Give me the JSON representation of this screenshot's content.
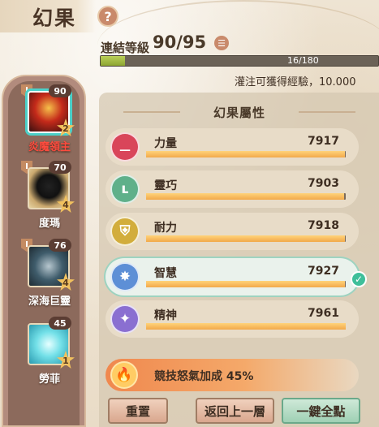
{
  "header": {
    "title": "幻果",
    "help_icon": "question-icon"
  },
  "link_level": {
    "label": "連結等級",
    "value": "90/95",
    "list_icon": "list-icon"
  },
  "experience": {
    "text": "16/180",
    "progress_fraction": 0.089,
    "fill_color": "#9db73f"
  },
  "infuse_text": "灌注可獲得經驗，10.000",
  "characters": [
    {
      "name": "炎魔領主",
      "level": "90",
      "stars": "2",
      "selected": true
    },
    {
      "name": "度瑪",
      "level": "70",
      "stars": "4",
      "selected": false
    },
    {
      "name": "深海巨靈",
      "level": "76",
      "stars": "4",
      "selected": false
    },
    {
      "name": "勞菲",
      "level": "45",
      "stars": "1",
      "selected": false
    }
  ],
  "attributes_panel": {
    "title": "幻果屬性",
    "items": [
      {
        "label": "力量",
        "value": "7917",
        "icon": "dumbbell-icon",
        "icon_color": "#d9455a",
        "progress_fraction": 0.995
      },
      {
        "label": "靈巧",
        "value": "7903",
        "icon": "boot-icon",
        "icon_color": "#5fb08a",
        "progress_fraction": 0.993
      },
      {
        "label": "耐力",
        "value": "7918",
        "icon": "shield-icon",
        "icon_color": "#d2ad3c",
        "progress_fraction": 0.995
      },
      {
        "label": "智慧",
        "value": "7927",
        "icon": "gear-icon",
        "icon_color": "#5d8fd6",
        "progress_fraction": 0.996
      },
      {
        "label": "精神",
        "value": "7961",
        "icon": "spirit-icon",
        "icon_color": "#8a6fd1",
        "progress_fraction": 1.0
      }
    ],
    "bonus": {
      "label": "競技怒氣加成 45%",
      "icon": "flame-icon"
    }
  },
  "buttons": {
    "reset": "重置",
    "back": "返回上一層",
    "all_points": "一鍵全點"
  },
  "colors": {
    "accent_bar": "#f2a94a",
    "selected_ring": "#4bd0c8",
    "selected_name": "#ff4b3e"
  }
}
